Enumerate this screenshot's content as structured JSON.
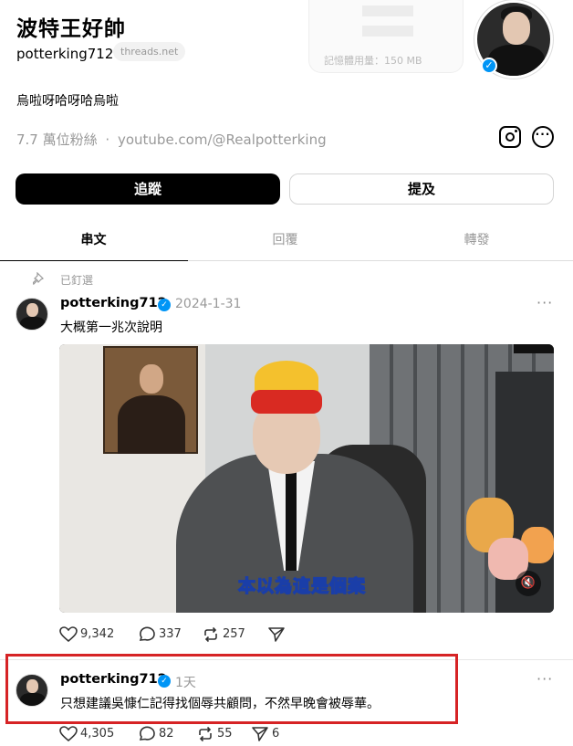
{
  "profile": {
    "display_name": "波特王好帥",
    "username": "potterking712",
    "domain_badge": "threads.net",
    "bio": "烏啦呀哈呀哈烏啦",
    "followers": "7.7 萬位粉絲",
    "separator": "·",
    "link": "youtube.com/@Realpotterking",
    "background_card_text": "記憶體用量：150 MB"
  },
  "buttons": {
    "follow": "追蹤",
    "mention": "提及"
  },
  "tabs": [
    {
      "label": "串文",
      "active": true
    },
    {
      "label": "回覆",
      "active": false
    },
    {
      "label": "轉發",
      "active": false
    }
  ],
  "posts": [
    {
      "pinned_label": "已釘選",
      "username": "potterking712",
      "date": "2024-1-31",
      "text": "大概第一兆次說明",
      "video_caption": "本以為這是個案",
      "likes": "9,342",
      "comments": "337",
      "reposts": "257",
      "shares": ""
    },
    {
      "username": "potterking712",
      "date": "1天",
      "text": "只想建議吳慷仁記得找個辱共顧問，不然早晚會被辱華。",
      "likes": "4,305",
      "comments": "82",
      "reposts": "55",
      "shares": "6"
    }
  ],
  "colors": {
    "verified": "#0095f6",
    "highlight": "#d62325",
    "muted_text": "#999999"
  }
}
